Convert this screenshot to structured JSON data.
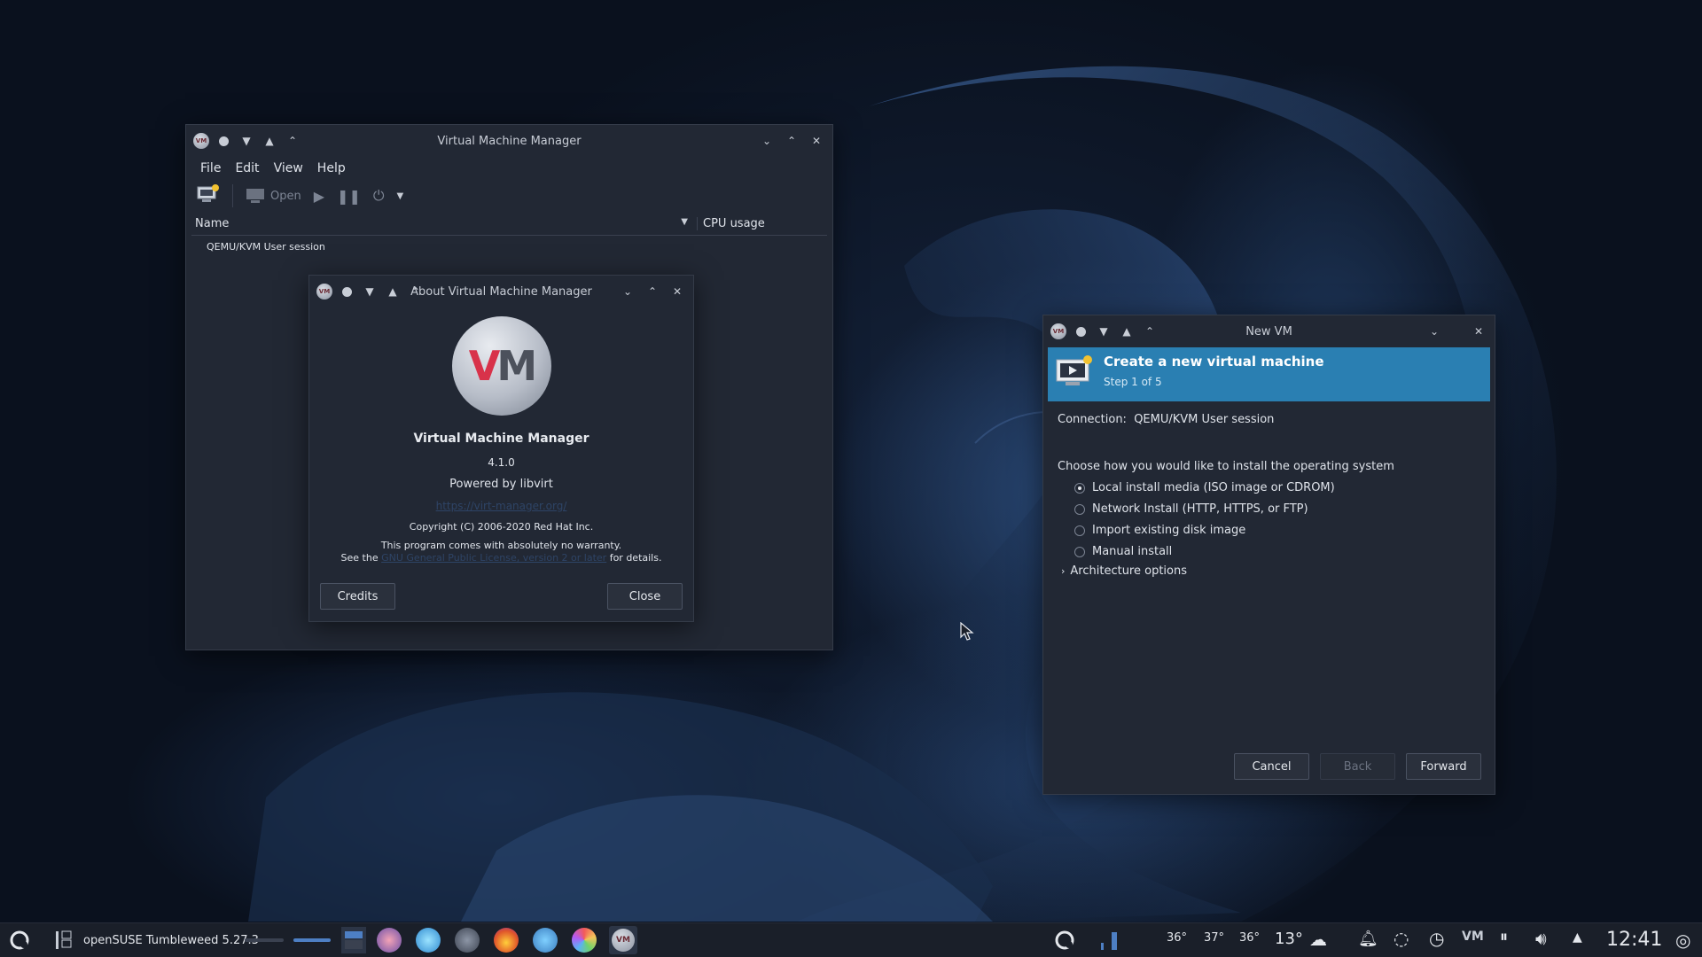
{
  "main_window": {
    "title": "Virtual Machine Manager",
    "menu": [
      "File",
      "Edit",
      "View",
      "Help"
    ],
    "toolbar": {
      "open_label": "Open"
    },
    "columns": {
      "name": "Name",
      "cpu": "CPU usage"
    },
    "rows": [
      "QEMU/KVM User session"
    ]
  },
  "about_dialog": {
    "title": "About Virtual Machine Manager",
    "logo_text": "VM",
    "app_name": "Virtual Machine Manager",
    "version": "4.1.0",
    "powered_by": "Powered by libvirt",
    "website": "https://virt-manager.org/",
    "copyright": "Copyright (C) 2006-2020 Red Hat Inc.",
    "warranty": "This program comes with absolutely no warranty.",
    "license_prefix": "See the",
    "license_link": "GNU General Public License, version 2 or later",
    "license_suffix": "for details.",
    "credits_button": "Credits",
    "close_button": "Close"
  },
  "new_vm": {
    "title": "New VM",
    "banner_title": "Create a new virtual machine",
    "banner_step": "Step 1 of 5",
    "connection_label": "Connection:",
    "connection_value": "QEMU/KVM User session",
    "prompt": "Choose how you would like to install the operating system",
    "options": [
      {
        "label": "Local install media (ISO image or CDROM)",
        "selected": true
      },
      {
        "label": "Network Install (HTTP, HTTPS, or FTP)",
        "selected": false
      },
      {
        "label": "Import existing disk image",
        "selected": false
      },
      {
        "label": "Manual install",
        "selected": false
      }
    ],
    "arch_label": "Architecture options",
    "cancel_button": "Cancel",
    "back_button": "Back",
    "forward_button": "Forward"
  },
  "taskbar": {
    "task_label": "openSUSE Tumbleweed 5.27.3",
    "temps": [
      "36°",
      "37°",
      "36°"
    ],
    "weather": "13°",
    "clock": "12:41"
  },
  "colors": {
    "accent": "#2a7fb2",
    "window_bg": "#222834",
    "taskbar_bg": "#1a1f29"
  }
}
